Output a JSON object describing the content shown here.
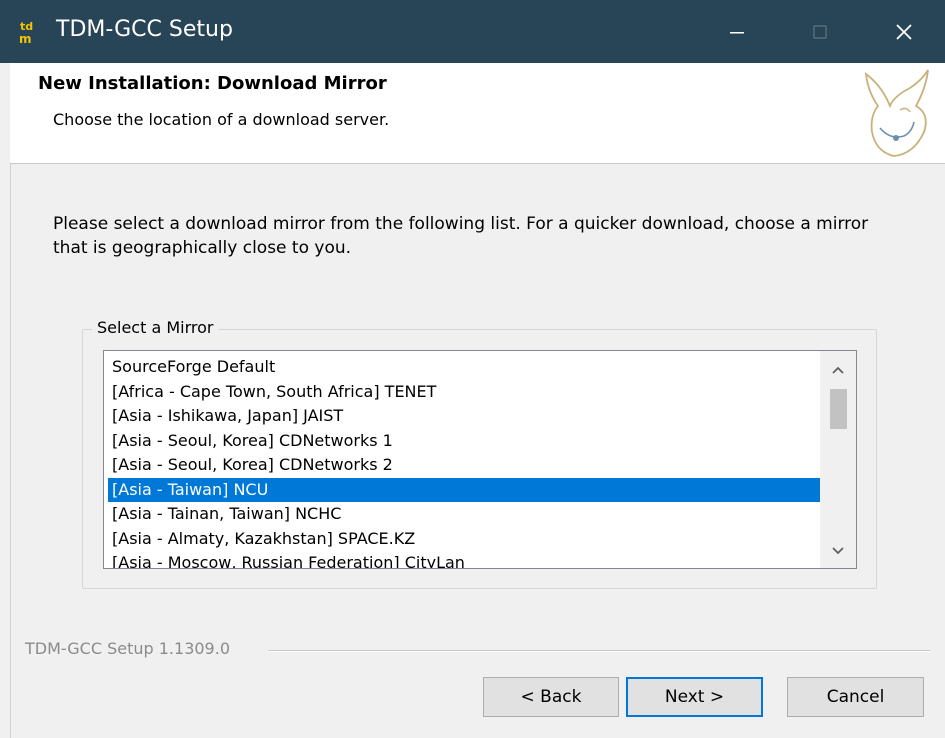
{
  "window": {
    "title": "TDM-GCC Setup",
    "icon": "tdm-gcc-app-icon",
    "controls": [
      "minimize-icon",
      "maximize-icon",
      "close-icon"
    ]
  },
  "header": {
    "title": "New Installation: Download Mirror",
    "subtitle": "Choose the location of a download server.",
    "logo": "tdm-fox-logo"
  },
  "description": "Please select a download mirror from the following list. For a quicker download, choose a mirror that is geographically close to you.",
  "mirror_group": {
    "label": "Select a Mirror",
    "selected_index": 5,
    "items": [
      "SourceForge Default",
      "[Africa - Cape Town, South Africa] TENET",
      "[Asia - Ishikawa, Japan] JAIST",
      "[Asia - Seoul, Korea] CDNetworks 1",
      "[Asia - Seoul, Korea] CDNetworks 2",
      "[Asia - Taiwan] NCU",
      "[Asia - Tainan, Taiwan] NCHC",
      "[Asia - Almaty, Kazakhstan] SPACE.KZ",
      "[Asia - Moscow, Russian Federation] CityLan"
    ]
  },
  "footer": {
    "version_text": "TDM-GCC Setup 1.1309.0",
    "back_label": "< Back",
    "next_label": "Next >",
    "cancel_label": "Cancel"
  },
  "colors": {
    "titlebar": "#284557",
    "selection": "#0078d7",
    "default_button_border": "#0078d7"
  }
}
